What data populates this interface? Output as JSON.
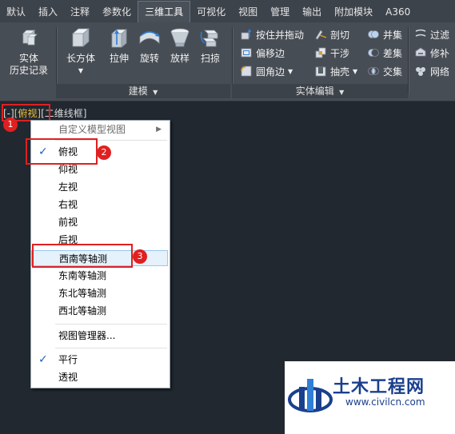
{
  "tabs": [
    "默认",
    "插入",
    "注释",
    "参数化",
    "三维工具",
    "可视化",
    "视图",
    "管理",
    "输出",
    "附加模块",
    "A360"
  ],
  "active_tab": "三维工具",
  "ribbon": {
    "history_line1": "实体",
    "history_line2": "历史记录",
    "box": "长方体",
    "extrude": "拉伸",
    "revolve": "旋转",
    "loft": "放样",
    "sweep": "扫掠",
    "press_pull": "按住并拖动",
    "offset_edge": "偏移边",
    "fillet_edge": "圆角边",
    "slice": "剖切",
    "interfere": "干涉",
    "shell": "抽壳",
    "union": "并集",
    "subtract": "差集",
    "intersect": "交集",
    "filter": "过滤",
    "repair": "修补",
    "mesh": "网络",
    "panel_modeling": "建模",
    "panel_solid_edit": "实体编辑"
  },
  "viewport": {
    "pre": "[-]",
    "view": "[俯视]",
    "style": "[二维线框]"
  },
  "menu": {
    "custom": "自定义模型视图",
    "items": [
      "俯视",
      "仰视",
      "左视",
      "右视",
      "前视",
      "后视",
      "西南等轴测",
      "东南等轴测",
      "东北等轴测",
      "西北等轴测"
    ],
    "view_manager": "视图管理器...",
    "parallel": "平行",
    "perspective": "透视",
    "checked": [
      "俯视",
      "平行"
    ]
  },
  "badges": [
    "1",
    "2",
    "3"
  ],
  "watermark": {
    "name": "土木工程网",
    "url": "www.civilcn.com"
  },
  "colors": {
    "annotation": "#e02020",
    "check": "#1e5fc2",
    "highlight": "#f0c040"
  }
}
